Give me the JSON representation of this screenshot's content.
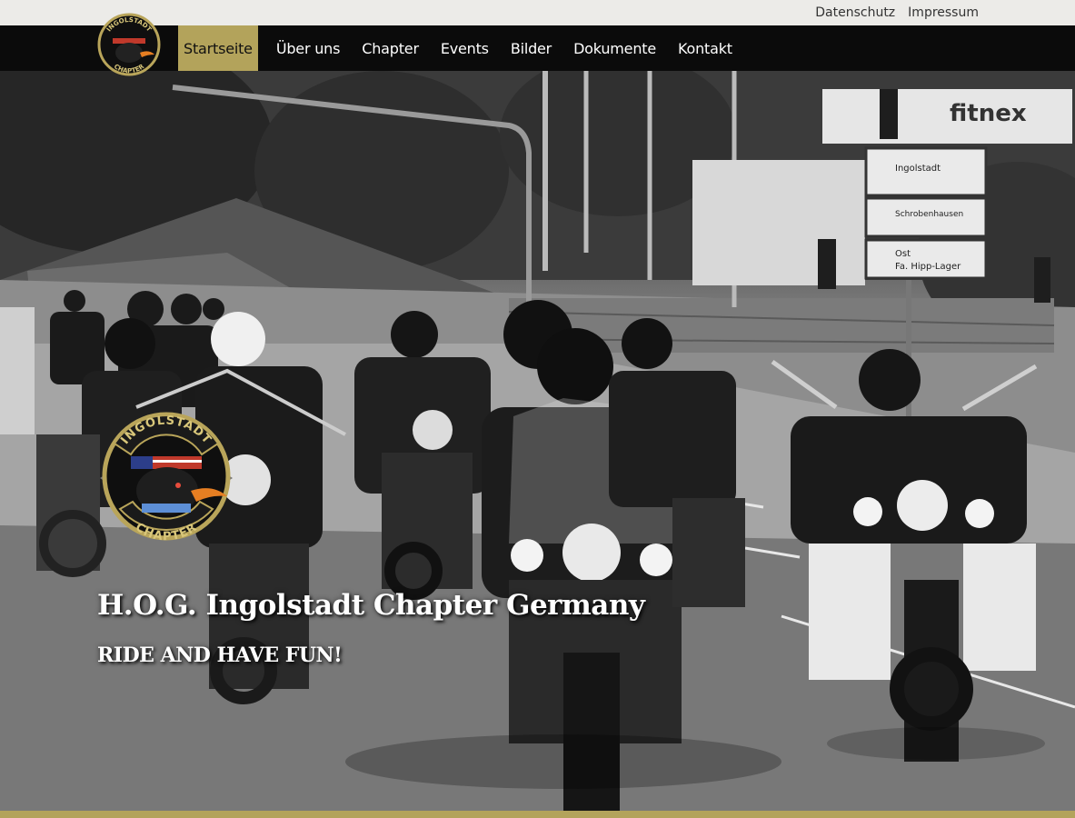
{
  "topbar": {
    "links": [
      {
        "label": "Datenschutz"
      },
      {
        "label": "Impressum"
      }
    ]
  },
  "nav": {
    "items": [
      {
        "label": "Startseite",
        "active": true
      },
      {
        "label": "Über uns"
      },
      {
        "label": "Chapter"
      },
      {
        "label": "Events"
      },
      {
        "label": "Bilder"
      },
      {
        "label": "Dokumente"
      },
      {
        "label": "Kontakt"
      }
    ]
  },
  "logo": {
    "top_text": "INGOLSTADT",
    "bottom_text": "CHAPTER"
  },
  "hero": {
    "title": "H.O.G. Ingolstadt Chapter Germany",
    "tagline": "RIDE AND HAVE FUN!",
    "signs": {
      "billboard": "fitnex",
      "dest1": "Ingolstadt",
      "dest2": "Schrobenhausen",
      "dest3": "Ost",
      "dest4": "Fa. Hipp-Lager"
    }
  },
  "colors": {
    "accent": "#b3a35b",
    "nav_bg": "#0b0b0b",
    "topbar_bg": "#ecebe8"
  }
}
